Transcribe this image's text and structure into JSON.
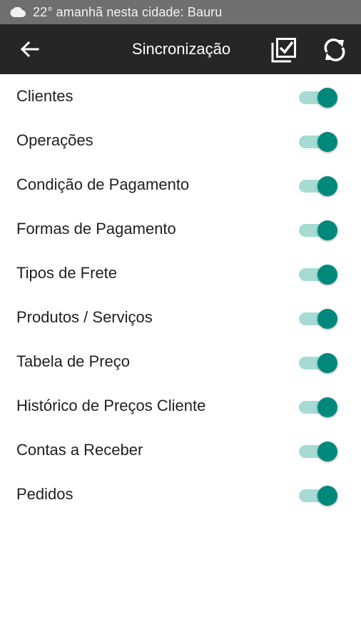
{
  "status_bar": {
    "weather_icon": "cloud-icon",
    "text": "22° amanhã nesta cidade: Bauru"
  },
  "app_bar": {
    "back_icon": "arrow-left-icon",
    "title": "Sincronização",
    "select_all_icon": "checkbox-multiple-icon",
    "sync_icon": "sync-icon"
  },
  "colors": {
    "status_bar": "#6f6f6f",
    "app_bar": "#262626",
    "switch_thumb": "#00897b",
    "switch_track": "#a6dbd4"
  },
  "items": [
    {
      "label": "Clientes",
      "enabled": true
    },
    {
      "label": "Operações",
      "enabled": true
    },
    {
      "label": "Condição de Pagamento",
      "enabled": true
    },
    {
      "label": "Formas de Pagamento",
      "enabled": true
    },
    {
      "label": "Tipos de Frete",
      "enabled": true
    },
    {
      "label": "Produtos / Serviços",
      "enabled": true
    },
    {
      "label": "Tabela de Preço",
      "enabled": true
    },
    {
      "label": "Histórico de Preços Cliente",
      "enabled": true
    },
    {
      "label": "Contas a Receber",
      "enabled": true
    },
    {
      "label": "Pedidos",
      "enabled": true
    }
  ]
}
